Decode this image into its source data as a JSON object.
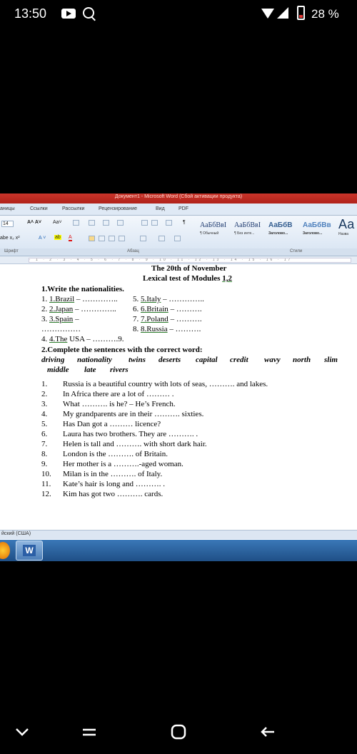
{
  "status_bar": {
    "time": "13:50",
    "battery_percent": "28 %"
  },
  "word": {
    "title": "Документ1 - Microsoft Word (Сбой активации продукта)",
    "tabs": [
      "аницы",
      "Ссылки",
      "Рассылки",
      "Рецензирование",
      "Вид",
      "PDF"
    ],
    "font_size": "14",
    "styles": [
      {
        "sample": "АаБбВвI",
        "caption": "¶ Обычный"
      },
      {
        "sample": "АаБбВвI",
        "caption": "¶ Без инте..."
      },
      {
        "sample": "АаБбВ",
        "caption": "Заголово..."
      },
      {
        "sample": "АаБбВв",
        "caption": "Заголово..."
      },
      {
        "sample": "Аа",
        "caption": "Назва"
      }
    ],
    "groups": {
      "font": "Шрифт",
      "paragraph": "Абзац",
      "styles": "Стили"
    },
    "language": "йский (США)"
  },
  "document": {
    "title": "The 20th of November",
    "subtitle_prefix": "Lexical test of Modules ",
    "subtitle_modules": "1,2",
    "task1": "1.Write the nationalities.",
    "nationalities": [
      {
        "n": "1. ",
        "word": "1.Brazil",
        "rest": " – …………..",
        "n2": "5. ",
        "word2": "5.Italy",
        "rest2": " –  ………….."
      },
      {
        "n": "2. ",
        "word": "2.Japan",
        "rest": " – …………..",
        "n2": "6. ",
        "word2": "6.Britain",
        "rest2": " –  ………."
      },
      {
        "n": "3. ",
        "word": "3.Spain",
        "rest": " –",
        "n2": "7. ",
        "word2": "7.Poland",
        "rest2": " –  ………."
      },
      {
        "n": "",
        "word": "",
        "rest": "……………",
        "n2": "8. ",
        "word2": "8.Russia",
        "rest2": " –  ………."
      },
      {
        "n": "4. ",
        "word": "4.The",
        "rest": " USA –  ……….9.",
        "n2": "",
        "word2": "",
        "rest2": ""
      }
    ],
    "task2": "2.Complete the sentences with the correct word:",
    "words_row1": [
      "driving",
      "nationality",
      "twins",
      "deserts",
      "capital",
      "credit",
      "wavy",
      "north",
      "slim"
    ],
    "words_row2": [
      "middle",
      "late",
      "rivers"
    ],
    "sentences": [
      {
        "n": "1.",
        "text": "Russia is a beautiful country with lots of seas, ………. and lakes."
      },
      {
        "n": "2.",
        "text": "In Africa there are a lot of ………  ."
      },
      {
        "n": "3.",
        "text": "What ………. is he? –  He’s  French."
      },
      {
        "n": "4.",
        "text": "My grandparents are in their ………. sixties."
      },
      {
        "n": "5.",
        "text": "Has Dan got a ……… licence?"
      },
      {
        "n": "6.",
        "text": "Laura has two brothers. They are ……….  ."
      },
      {
        "n": "7.",
        "text": "Helen is tall and ………. with short dark hair."
      },
      {
        "n": "8.",
        "text": "London is the ………. of Britain."
      },
      {
        "n": "9.",
        "text": "Her mother is a ……….-aged woman."
      },
      {
        "n": "10.",
        "text": "Milan is in the ………. of Italy."
      },
      {
        "n": "11.",
        "text": "Kate’s hair is long and ………. ."
      },
      {
        "n": "12.",
        "text": "Kim has got two ………. cards."
      }
    ]
  }
}
